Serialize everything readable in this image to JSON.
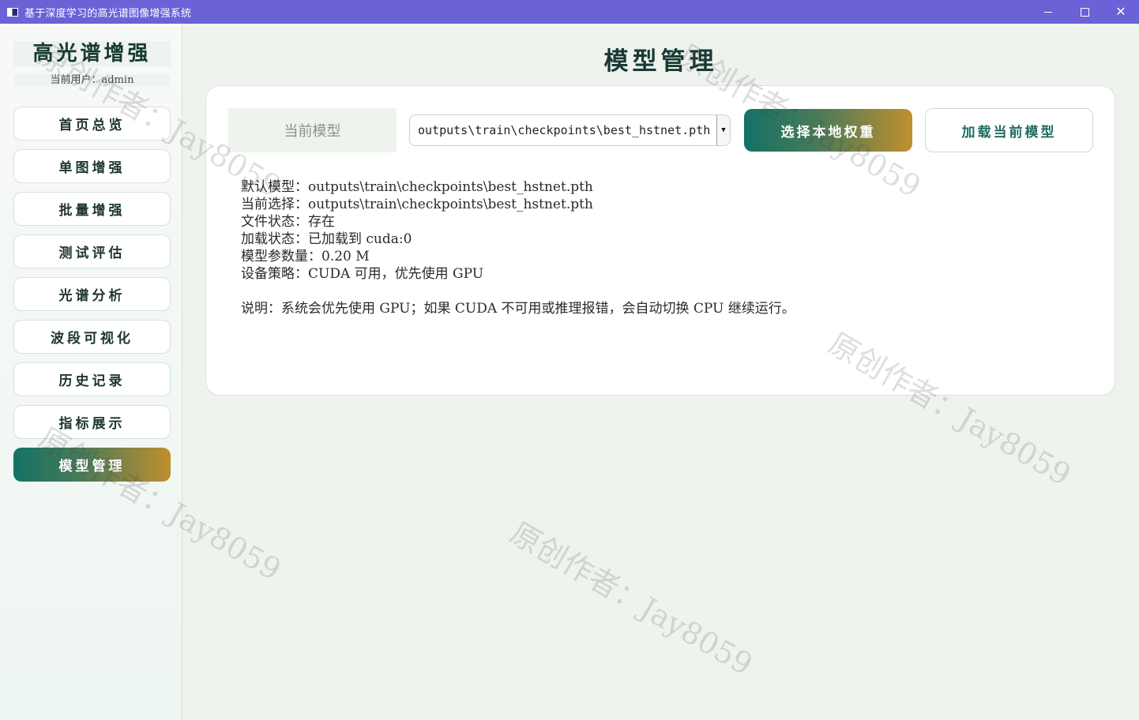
{
  "window": {
    "title": "基于深度学习的高光谱图像增强系统",
    "controls": [
      "minimize",
      "maximize",
      "close"
    ]
  },
  "sidebar": {
    "brand": "高光谱增强",
    "user_label": "当前用户：admin",
    "items": [
      {
        "label": "首页总览"
      },
      {
        "label": "单图增强"
      },
      {
        "label": "批量增强"
      },
      {
        "label": "测试评估"
      },
      {
        "label": "光谱分析"
      },
      {
        "label": "波段可视化"
      },
      {
        "label": "历史记录"
      },
      {
        "label": "指标展示"
      },
      {
        "label": "模型管理",
        "active": true
      }
    ]
  },
  "main": {
    "title": "模型管理",
    "model_label": "当前模型",
    "model_select": {
      "value": "outputs\\train\\checkpoints\\best_hstnet.pth"
    },
    "choose_button": "选择本地权重",
    "load_button": "加载当前模型",
    "info_lines": [
      "默认模型：outputs\\train\\checkpoints\\best_hstnet.pth",
      "当前选择：outputs\\train\\checkpoints\\best_hstnet.pth",
      "文件状态：存在",
      "加载状态：已加载到 cuda:0",
      "模型参数量：0.20 M",
      "设备策略：CUDA 可用，优先使用 GPU"
    ],
    "note": "说明：系统会优先使用 GPU；如果 CUDA 不可用或推理报错，会自动切换 CPU 继续运行。"
  },
  "watermark": "原创作者：Jay8059",
  "colors": {
    "titlebar": "#6a62d6",
    "accent_start": "#137265",
    "accent_end": "#c08f2e",
    "background": "#eef3ee"
  }
}
